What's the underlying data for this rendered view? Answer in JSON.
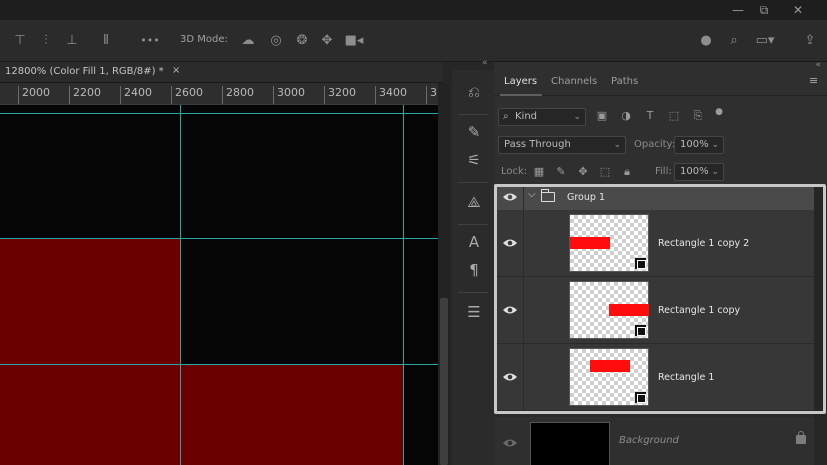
{
  "window": {
    "minimize_glyph": "—",
    "restore_glyph": "⧉",
    "close_glyph": "✕"
  },
  "options_bar": {
    "align_icons": [
      "align-top-icon",
      "align-vcenter-icon",
      "align-bottom-icon",
      "distribute-icon"
    ],
    "more_glyph": "•••",
    "mode_label": "3D Mode:",
    "mode_icons": [
      "orbit-3d-icon",
      "roll-3d-icon",
      "drag-3d-icon",
      "slide-3d-icon",
      "camera-3d-icon"
    ],
    "right_icons": [
      "account-icon",
      "search-icon",
      "workspace-icon",
      "share-icon"
    ]
  },
  "document": {
    "tab_title": "12800% (Color Fill 1, RGB/8#) *",
    "close_glyph": "×",
    "ruler_ticks": [
      "2000",
      "2200",
      "2400",
      "2600",
      "2800",
      "3000",
      "3200",
      "3400",
      "3"
    ]
  },
  "canvas": {
    "dark_color": "#050505",
    "red_color": "#6a0000",
    "guide_color": "#2aa6a0"
  },
  "panel": {
    "collapse_glyph": "«",
    "tabs": [
      {
        "label": "Layers",
        "active": true
      },
      {
        "label": "Channels",
        "active": false
      },
      {
        "label": "Paths",
        "active": false
      }
    ],
    "filter": {
      "value": "Kind"
    },
    "blend_mode": {
      "value": "Pass Through"
    },
    "opacity": {
      "label": "Opacity:",
      "value": "100%"
    },
    "lock": {
      "label": "Lock:"
    },
    "fill": {
      "label": "Fill:",
      "value": "100%"
    },
    "layers": {
      "group": {
        "name": "Group 1"
      },
      "children": [
        {
          "name": "Rectangle 1 copy 2"
        },
        {
          "name": "Rectangle 1 copy"
        },
        {
          "name": "Rectangle 1"
        }
      ],
      "background": {
        "name": "Background"
      }
    }
  }
}
